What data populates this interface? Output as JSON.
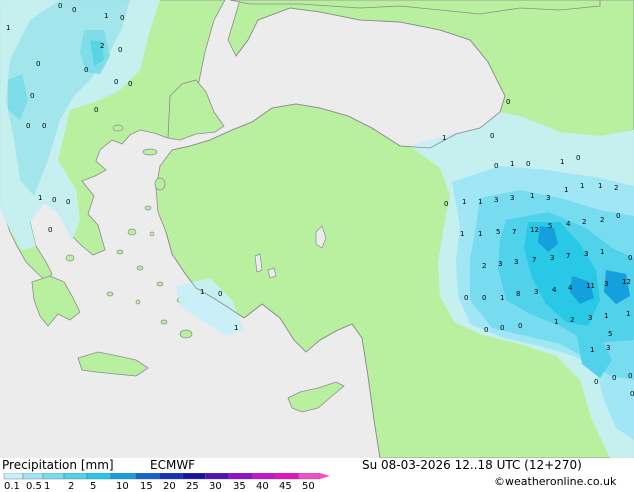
{
  "footer": {
    "title": "Precipitation [mm]",
    "model": "ECMWF",
    "datetime": "Su 08-03-2026 12..18 UTC (12+270)",
    "credit": "©weatheronline.co.uk"
  },
  "legend": {
    "ticks": [
      "0.1",
      "0.5",
      "1",
      "2",
      "5",
      "10",
      "15",
      "20",
      "25",
      "30",
      "35",
      "40",
      "45",
      "50"
    ],
    "colors": [
      "#c8f0f8",
      "#a0e6f5",
      "#78dcf0",
      "#50d2eb",
      "#28c8e6",
      "#14a0dc",
      "#1464c8",
      "#1432b4",
      "#1414a0",
      "#5014b4",
      "#8c14c8",
      "#c814c8",
      "#e614b4",
      "#f050c8"
    ]
  },
  "map_colors": {
    "sea": "#ececec",
    "land": "#b8f0a0",
    "coast": "#8c8c8c",
    "precip_light": "#c8f0f8",
    "precip_mid": "#78dcf0",
    "precip_heavy": "#28a8e6"
  },
  "values": [
    {
      "t": "0"
    },
    {
      "t": "0"
    },
    {
      "t": "1"
    },
    {
      "t": "0"
    },
    {
      "t": "1"
    },
    {
      "t": "2"
    },
    {
      "t": "0"
    },
    {
      "t": "0"
    },
    {
      "t": "0"
    },
    {
      "t": "0"
    },
    {
      "t": "0"
    },
    {
      "t": "0"
    },
    {
      "t": "0"
    },
    {
      "t": "0"
    },
    {
      "t": "0"
    },
    {
      "t": "0"
    },
    {
      "t": "0"
    },
    {
      "t": "0"
    },
    {
      "t": "1"
    },
    {
      "t": "1"
    },
    {
      "t": "0"
    },
    {
      "t": "1"
    },
    {
      "t": "0"
    },
    {
      "t": "0"
    },
    {
      "t": "1"
    },
    {
      "t": "0"
    },
    {
      "t": "1"
    },
    {
      "t": "0"
    },
    {
      "t": "1"
    },
    {
      "t": "0"
    },
    {
      "t": "0"
    },
    {
      "t": "1"
    },
    {
      "t": "1"
    },
    {
      "t": "3"
    },
    {
      "t": "3"
    },
    {
      "t": "1"
    },
    {
      "t": "3"
    },
    {
      "t": "1"
    },
    {
      "t": "1"
    },
    {
      "t": "1"
    },
    {
      "t": "2"
    },
    {
      "t": "1"
    },
    {
      "t": "1"
    },
    {
      "t": "5"
    },
    {
      "t": "7"
    },
    {
      "t": "12"
    },
    {
      "t": "5"
    },
    {
      "t": "4"
    },
    {
      "t": "2"
    },
    {
      "t": "2"
    },
    {
      "t": "2"
    },
    {
      "t": "3"
    },
    {
      "t": "3"
    },
    {
      "t": "7"
    },
    {
      "t": "3"
    },
    {
      "t": "7"
    },
    {
      "t": "3"
    },
    {
      "t": "1"
    },
    {
      "t": "0"
    },
    {
      "t": "0"
    },
    {
      "t": "8"
    },
    {
      "t": "3"
    },
    {
      "t": "4"
    },
    {
      "t": "4"
    },
    {
      "t": "11"
    },
    {
      "t": "3"
    },
    {
      "t": "12"
    },
    {
      "t": "0"
    },
    {
      "t": "0"
    },
    {
      "t": "1"
    },
    {
      "t": "1"
    },
    {
      "t": "2"
    },
    {
      "t": "3"
    },
    {
      "t": "1"
    },
    {
      "t": "1"
    },
    {
      "t": "0"
    },
    {
      "t": "0"
    },
    {
      "t": "0"
    },
    {
      "t": "1"
    },
    {
      "t": "3"
    },
    {
      "t": "5"
    },
    {
      "t": "0"
    },
    {
      "t": "0"
    },
    {
      "t": "0"
    },
    {
      "t": "0"
    }
  ]
}
